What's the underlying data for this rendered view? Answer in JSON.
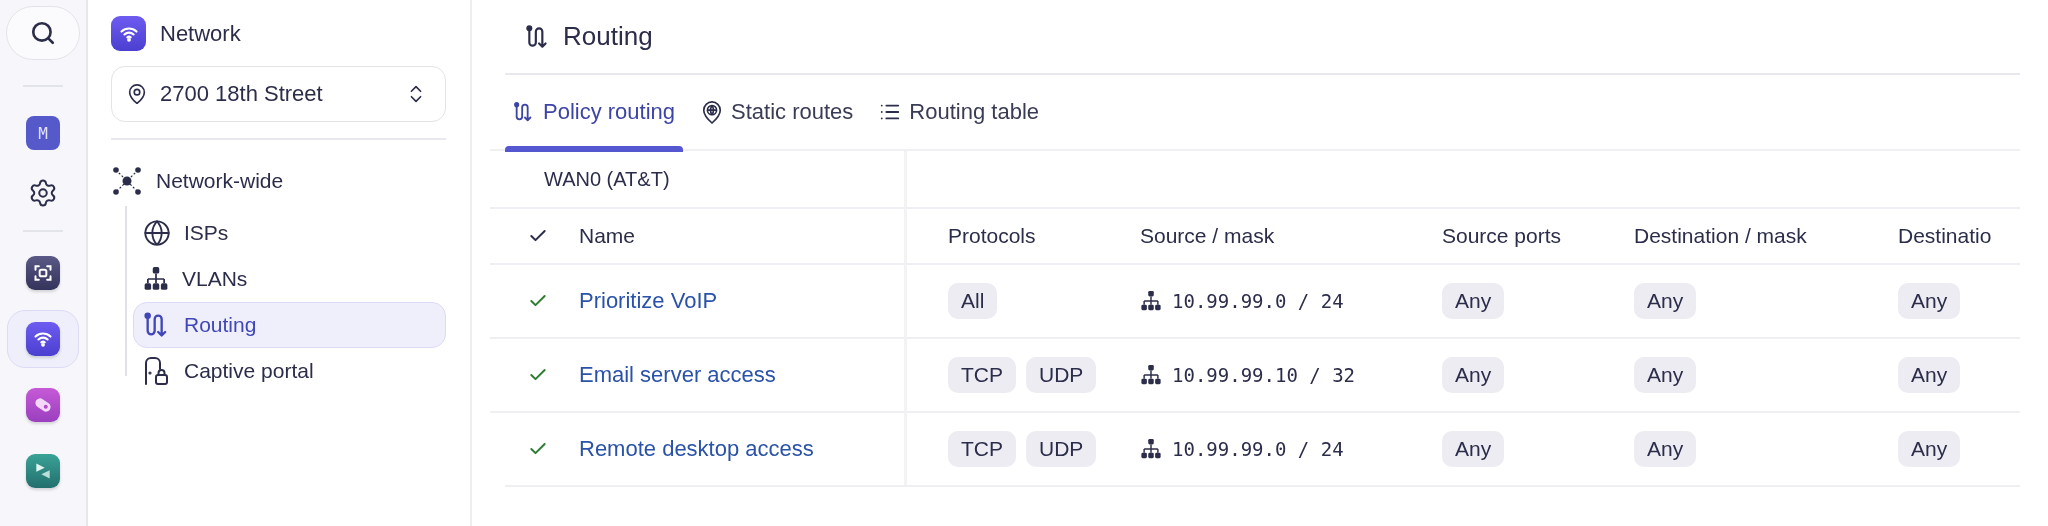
{
  "rail": {
    "avatar": "M",
    "apps": [
      {
        "selected": false
      },
      {
        "selected": true
      },
      {
        "selected": false
      },
      {
        "selected": false
      }
    ]
  },
  "sidebar": {
    "title": "Network",
    "location": "2700 18th Street",
    "tree": [
      {
        "label": "Network-wide",
        "selected": false,
        "children": [
          {
            "label": "ISPs",
            "selected": false
          },
          {
            "label": "VLANs",
            "selected": false
          },
          {
            "label": "Routing",
            "selected": true
          },
          {
            "label": "Captive portal",
            "selected": false
          }
        ]
      }
    ]
  },
  "page": {
    "title": "Routing"
  },
  "tabs": [
    {
      "label": "Policy routing",
      "selected": true
    },
    {
      "label": "Static routes",
      "selected": false
    },
    {
      "label": "Routing table",
      "selected": false
    }
  ],
  "table": {
    "group": "WAN0 (AT&T)",
    "columns": [
      "Name",
      "Protocols",
      "Source / mask",
      "Source ports",
      "Destination / mask",
      "Destinatio"
    ],
    "rows": [
      {
        "enabled": true,
        "name": "Prioritize VoIP",
        "protocols": [
          "All"
        ],
        "source": "10.99.99.0 / 24",
        "source_ports": "Any",
        "destination": "Any",
        "column_7": "Any"
      },
      {
        "enabled": true,
        "name": "Email server access",
        "protocols": [
          "TCP",
          "UDP"
        ],
        "source": "10.99.99.10 / 32",
        "source_ports": "Any",
        "destination": "Any",
        "column_7": "Any"
      },
      {
        "enabled": true,
        "name": "Remote desktop access",
        "protocols": [
          "TCP",
          "UDP"
        ],
        "source": "10.99.99.0 / 24",
        "source_ports": "Any",
        "destination": "Any",
        "column_7": "Any"
      }
    ]
  }
}
